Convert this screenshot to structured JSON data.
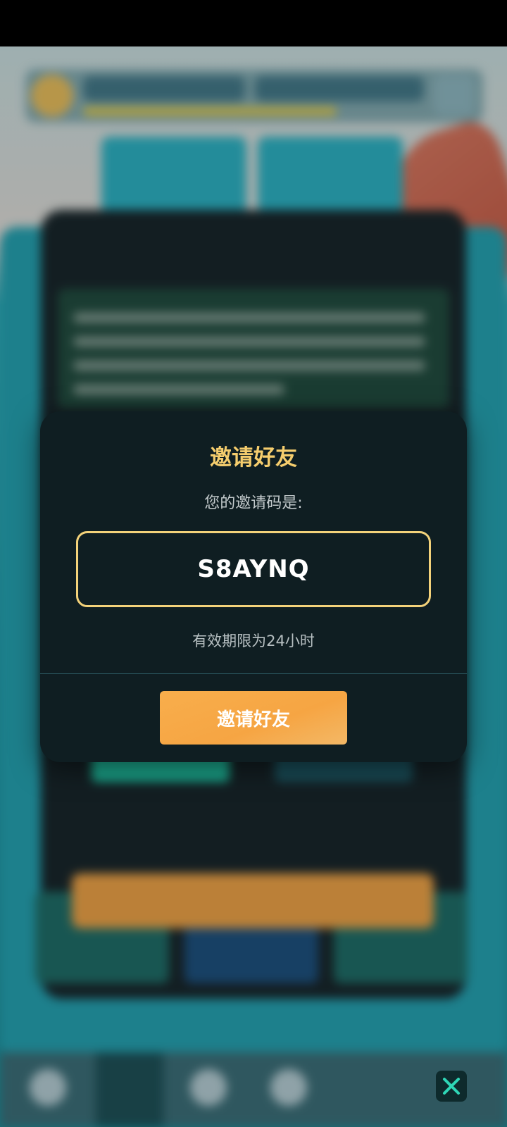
{
  "dialog": {
    "title": "邀请好友",
    "subtitle": "您的邀请码是:",
    "invite_code": "S8AYNQ",
    "validity": "有效期限为24小时",
    "button_label": "邀请好友"
  },
  "icons": {
    "close": "close-icon"
  },
  "colors": {
    "title_gold": "#f5cd6d",
    "code_border": "#f3d27a",
    "button_orange": "#f6a543",
    "dialog_bg": "#0f1e22",
    "close_icon": "#2fd6b6"
  }
}
